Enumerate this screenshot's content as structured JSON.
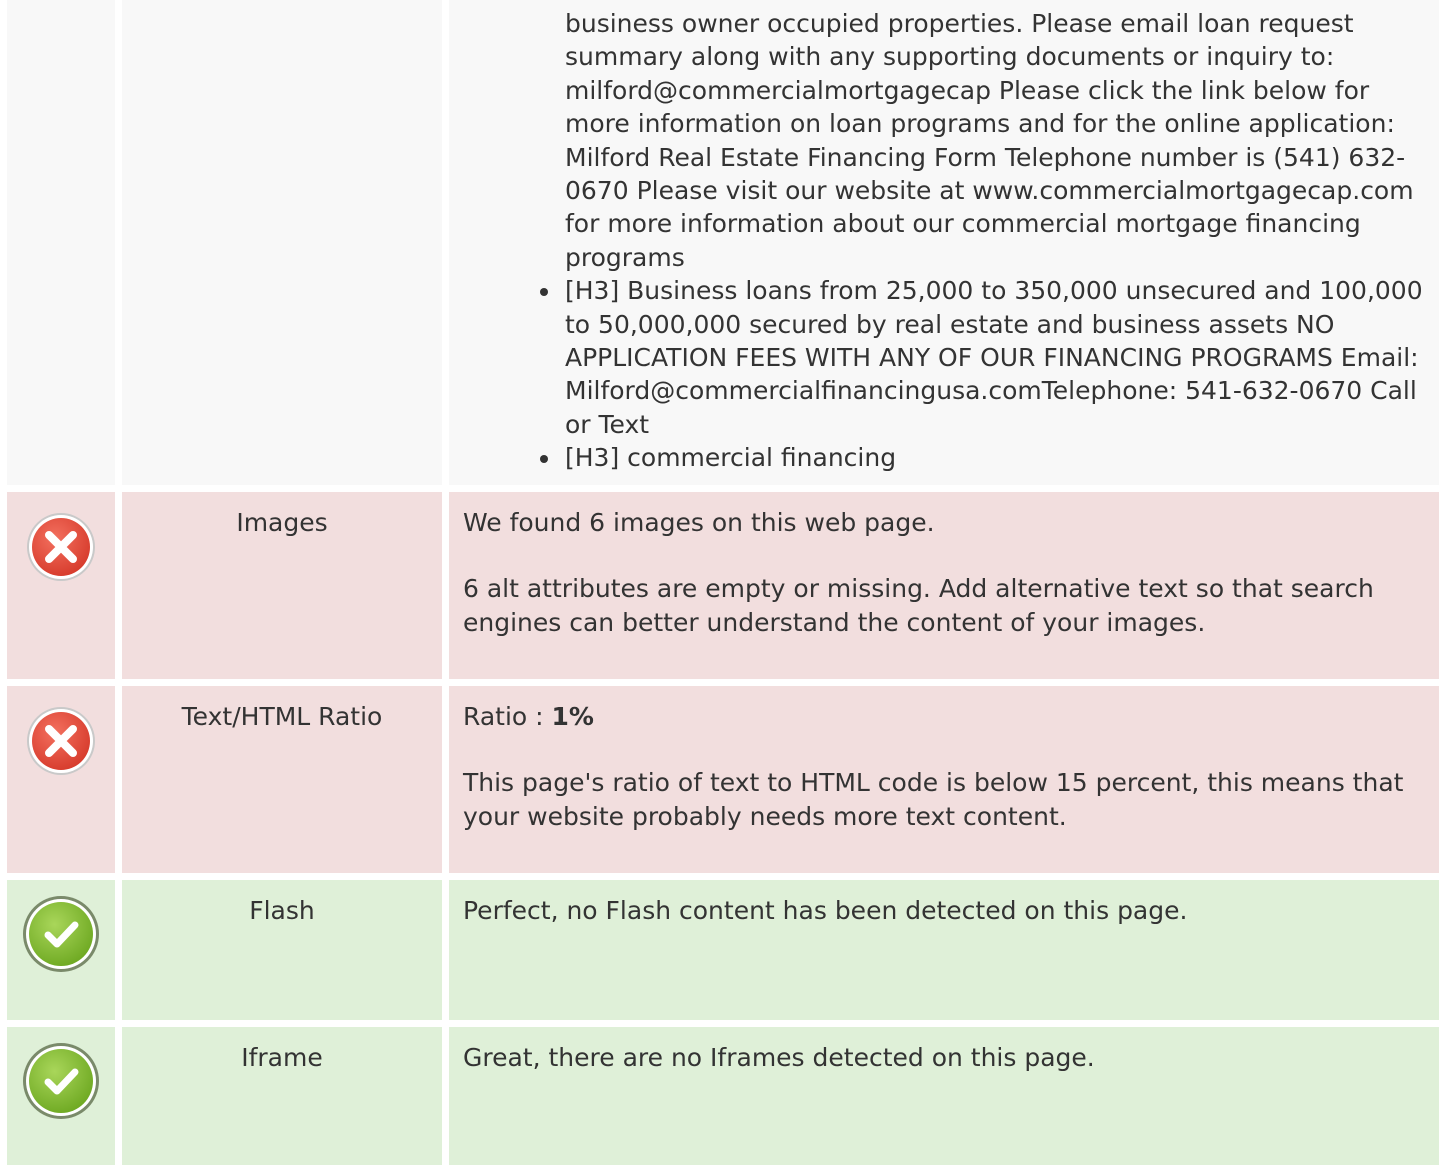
{
  "headings_section": {
    "items": [
      {
        "text": "business owner occupied properties. Please email loan request summary along with any supporting documents or inquiry to: milford@commercialmortgagecap Please click the link below for more information on loan programs and for the online application: Milford Real Estate Financing Form Telephone number is (541) 632-0670 Please visit our website at www.commercialmortgagecap.com for more information about our commercial mortgage financing programs",
        "continued": true
      },
      {
        "text": "[H3] Business loans from 25,000 to 350,000 unsecured and 100,000 to 50,000,000 secured by real estate and business assets NO APPLICATION FEES WITH ANY OF OUR FINANCING PROGRAMS Email: Milford@commercialfinancingusa.comTelephone: 541-632-0670 Call or Text",
        "continued": false
      },
      {
        "text": "[H3] commercial financing",
        "continued": false
      }
    ]
  },
  "checks": {
    "images": {
      "status": "fail",
      "name": "Images",
      "line1": "We found 6 images on this web page.",
      "line2": "6 alt attributes are empty or missing. Add alternative text so that search engines can better understand the content of your images."
    },
    "ratio": {
      "status": "fail",
      "name": "Text/HTML Ratio",
      "label": "Ratio : ",
      "value": "1%",
      "line2": "This page's ratio of text to HTML code is below 15 percent, this means that your website probably needs more text content."
    },
    "flash": {
      "status": "pass",
      "name": "Flash",
      "line1": "Perfect, no Flash content has been detected on this page."
    },
    "iframe": {
      "status": "pass",
      "name": "Iframe",
      "line1": "Great, there are no Iframes detected on this page."
    }
  },
  "icons": {
    "fail": "error-icon",
    "pass": "success-icon"
  },
  "colors": {
    "neutral_row": "#f8f8f8",
    "fail_row": "#f2dede",
    "pass_row": "#dff0d8",
    "fail_icon": "#e84c3d",
    "pass_icon": "#8cc63f",
    "text": "#333333"
  }
}
